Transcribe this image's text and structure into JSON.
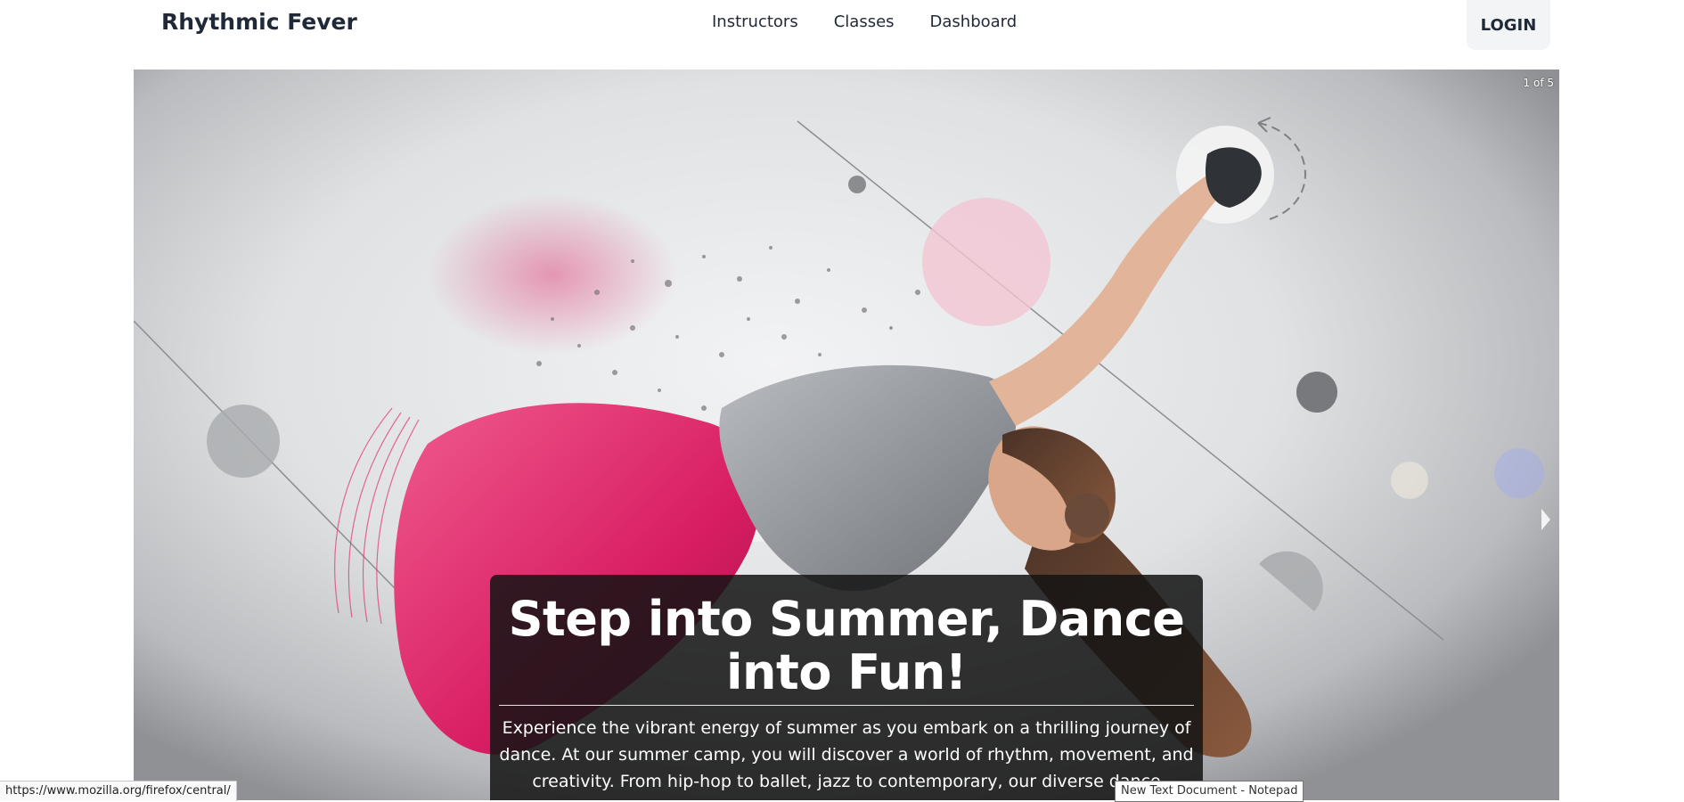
{
  "header": {
    "brand": "Rhythmic Fever",
    "nav": [
      {
        "label": "Instructors"
      },
      {
        "label": "Classes"
      },
      {
        "label": "Dashboard"
      }
    ],
    "login_label": "LOGIN"
  },
  "carousel": {
    "counter": "1 of 5",
    "caption": {
      "title": "Step into Summer, Dance into Fun!",
      "body": "Experience the vibrant energy of summer as you embark on a thrilling journey of dance. At our summer camp, you will discover a world of rhythm, movement, and creativity. From hip-hop to ballet, jazz to contemporary, our diverse dance classes offe"
    },
    "next_icon": "chevron-right-icon",
    "accent_color": "#e0306f"
  },
  "browser": {
    "status_url": "https://www.mozilla.org/firefox/central/",
    "tooltip": "New Text Document - Notepad"
  }
}
